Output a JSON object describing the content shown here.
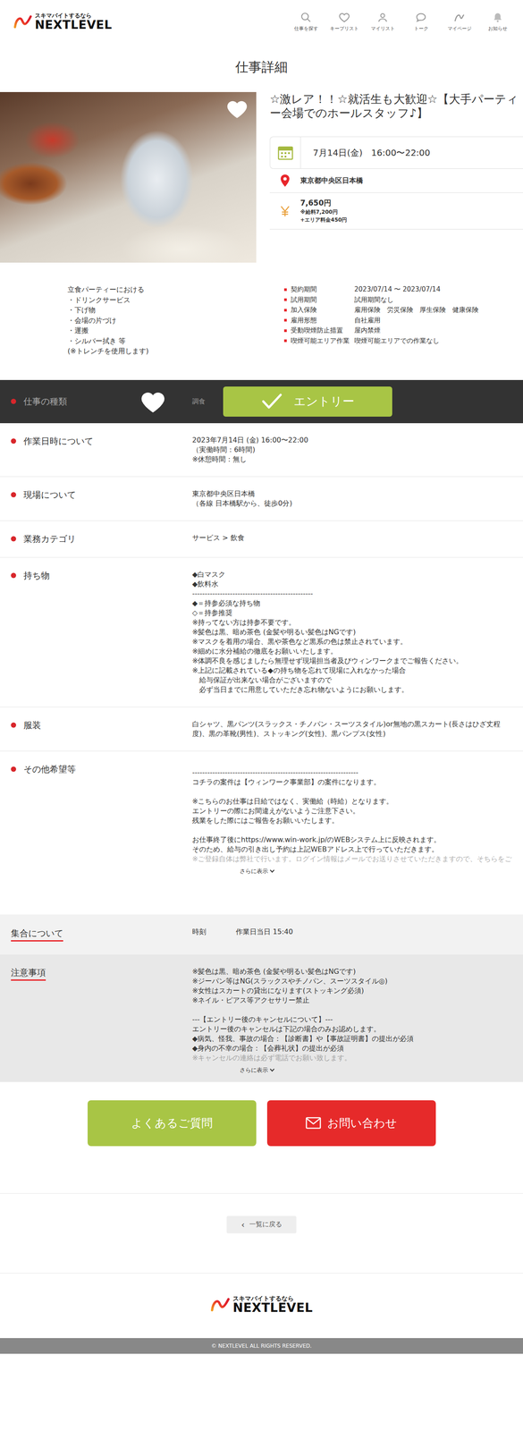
{
  "header": {
    "logo": {
      "tagline": "スキマバイトするなら",
      "name": "NEXTLEVEL"
    },
    "nav": [
      {
        "label": "仕事を探す",
        "icon": "search"
      },
      {
        "label": "キープリスト",
        "icon": "heart"
      },
      {
        "label": "マイリスト",
        "icon": "person"
      },
      {
        "label": "トーク",
        "icon": "chat"
      },
      {
        "label": "マイページ",
        "icon": "swoosh"
      },
      {
        "label": "お知らせ",
        "icon": "bell"
      }
    ]
  },
  "page_title": "仕事詳細",
  "job": {
    "title": "☆激レア！！☆就活生も大歓迎☆【大手パーティー会場でのホールスタッフ♪】",
    "date": "7月14日(金)　16:00〜22:00",
    "location": "東京都中央区日本橋",
    "pay": {
      "total": "7,650円",
      "base": "※給料7,200円",
      "area": "+エリア料金450円"
    }
  },
  "description": [
    "立食パーティーにおける",
    "・ドリンクサービス",
    "・下げ物",
    "・会場の片づけ",
    "・運搬",
    "・シルバー拭き 等",
    "(※トレンチを使用します)"
  ],
  "conditions": [
    {
      "label": "契約期間",
      "value": "2023/07/14 〜 2023/07/14"
    },
    {
      "label": "試用期間",
      "value": "試用期間なし"
    },
    {
      "label": "加入保険",
      "value": "雇用保険　労災保険　厚生保険　健康保険"
    },
    {
      "label": "雇用形態",
      "value": "自社雇用"
    },
    {
      "label": "受動喫煙防止措置",
      "value": "屋内禁煙"
    },
    {
      "label": "喫煙可能エリア作業",
      "value": "喫煙可能エリアでの作業なし"
    }
  ],
  "entry_bar": {
    "label": "仕事の種類",
    "value": "調食",
    "button": "エントリー"
  },
  "details": [
    {
      "label": "作業日時について",
      "lines": [
        "2023年7月14日 (金) 16:00〜22:00",
        "（実働時間：6時間)",
        "※休憩時間：無し"
      ]
    },
    {
      "label": "現場について",
      "lines": [
        "東京都中央区日本橋",
        "（各線 日本橋駅から、徒歩0分)"
      ]
    },
    {
      "label": "業務カテゴリ",
      "lines": [
        "サービス > 飲食"
      ]
    },
    {
      "label": "持ち物",
      "lines": [
        "◆白マスク",
        "◆飲料水",
        "------------------------------------------------",
        "◆＝持参必須な持ち物",
        "◇＝持参推奨",
        "※持ってない方は持参不要です。",
        "※髪色は黒、暗め茶色 (金髪や明るい髪色はNGです)",
        "※マスクを着用の場合、黒や茶色など黒系の色は禁止されています。",
        "※細めに水分補給の徹底をお願いいたします。",
        "※体調不良を感じましたら無理せず現場担当者及びウィンワークまでご報告ください。",
        "※上記に記載されている◆の持ち物を忘れて現場に入れなかった場合",
        "　給与保証が出来ない場合がございますので",
        "　必ず当日までに用意していただき忘れ物ないようにお願いします。"
      ]
    },
    {
      "label": "服装",
      "lines": [
        "白シャツ、黒パンツ(スラックス・チノパン・スーツスタイル)or無地の黒スカート(長さはひざ丈程度)、黒の革靴(男性)、ストッキング(女性)、黒パンプス(女性)"
      ]
    }
  ],
  "other": {
    "label": "その他希望等",
    "expanded": false,
    "more": "さらに表示",
    "lines": [
      "------------------------------------------------------------------",
      "コチラの案件は【ウィンワーク事業部】の案件になります。",
      "",
      "※こちらのお仕事は日給ではなく、実働給（時給）となります。",
      "エントリーの際にお間違えがないようご注意下さい。",
      "残業をした際にはご報告をお願いいたします。",
      "",
      "お仕事終了後にhttps://www.win-work.jp/のWEBシステム上に反映されます。",
      "そのため、給与の引き出し予約は上記WEBアドレス上で行っていただきます。",
      "※ご登録自体は弊社で行います。ログイン情報はメールでお送りさせていただきますので、そちらをご"
    ]
  },
  "meeting": {
    "label": "集合について",
    "key": "時刻",
    "value": "作業日当日 15:40"
  },
  "notes": {
    "label": "注意事項",
    "expanded": false,
    "more": "さらに表示",
    "lines": [
      "※髪色は黒、暗め茶色 (金髪や明るい髪色はNGです)",
      "※ジーパン等はNG(スラックスやチノパン、スーツスタイル◎)",
      "※女性はスカートの貸出になります(ストッキング必須)",
      "※ネイル・ピアス等アクセサリー禁止",
      "",
      "---【エントリー後のキャンセルについて】---",
      "エントリー後のキャンセルは下記の場合のみお認めします。",
      "◆病気、怪我、事故の場合：【診断書】や【事故証明書】の提出が必須",
      "◆身内の不幸の場合：【会葬礼状】の提出が必須",
      "※キャンセルの連絡は必ず電話でお願い致します。"
    ]
  },
  "buttons": [
    {
      "label": "よくあるご質問",
      "kind": "faq"
    },
    {
      "label": "お問い合わせ",
      "kind": "contact"
    }
  ],
  "back": {
    "icon": "‹",
    "label": "一覧に戻る"
  },
  "footer": {
    "logo": {
      "tagline": "スキマバイトするなら",
      "name": "NEXTLEVEL"
    },
    "copyright": "© NEXTLEVEL ALL RIGHTS RESERVED."
  }
}
